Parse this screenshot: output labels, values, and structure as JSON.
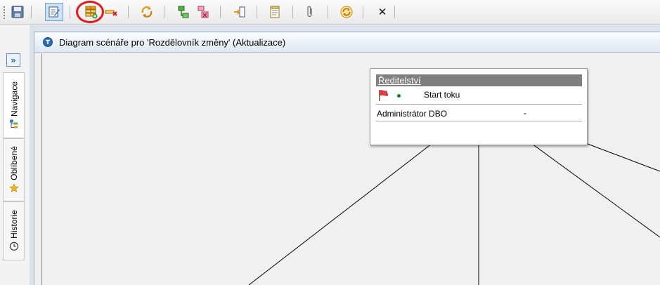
{
  "toolbar": {
    "buttons": [
      {
        "icon": "save-icon"
      },
      {
        "icon": "edit-form-icon",
        "active": true
      },
      {
        "icon": "add-table-icon",
        "highlighted": true
      },
      {
        "icon": "delete-row-icon"
      },
      {
        "icon": "refresh-arrows-icon"
      },
      {
        "icon": "flow-green-icon"
      },
      {
        "icon": "flow-red-icon"
      },
      {
        "icon": "import-icon"
      },
      {
        "icon": "notes-icon"
      },
      {
        "icon": "attachment-icon"
      },
      {
        "icon": "sync-icon"
      },
      {
        "icon": "close-icon"
      }
    ],
    "close_glyph": "✕"
  },
  "sidebar": {
    "expand_glyph": "»",
    "tabs": [
      {
        "label": "Navigace",
        "icon": "navigation-tree-icon",
        "selected": true
      },
      {
        "label": "Oblíbené",
        "icon": "star-icon",
        "selected": false
      },
      {
        "label": "Historie",
        "icon": "clock-icon",
        "selected": false
      }
    ]
  },
  "panel": {
    "title": "Diagram scénáře pro 'Rozdělovník změny' (Aktualizace)",
    "title_icon": "info-circle-icon"
  },
  "diagram": {
    "node": {
      "header": "Ředitelství",
      "start_label": "Start toku",
      "role": "Administrátor DBO",
      "role_value": "-"
    }
  },
  "colors": {
    "highlight_ring": "#e8161b",
    "node_header": "#7f7f7f",
    "start_dot": "#0a8a20"
  }
}
